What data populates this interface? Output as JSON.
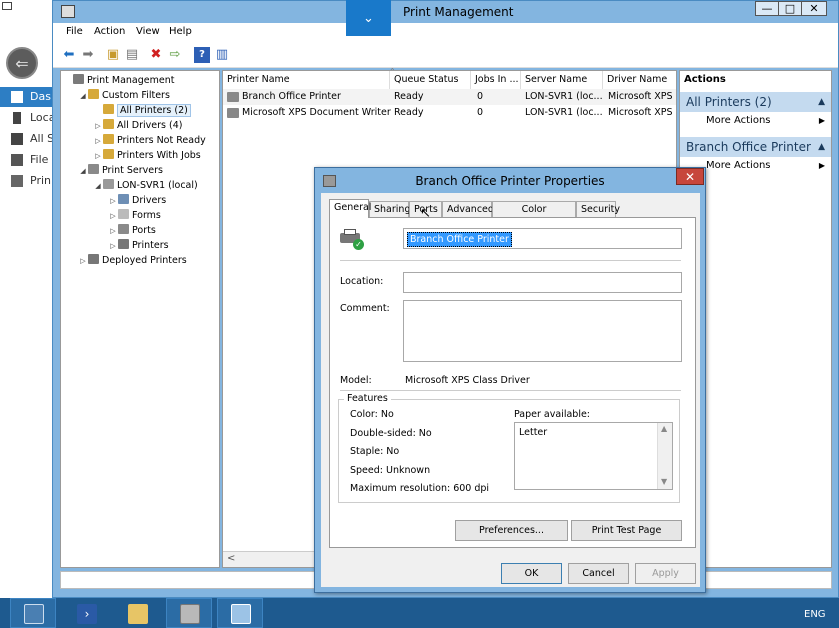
{
  "server_manager": {
    "sidebar": [
      {
        "label": "Das",
        "icon": "dashboard-icon",
        "active": true
      },
      {
        "label": "Loca",
        "icon": "local-server-icon",
        "active": false
      },
      {
        "label": "All S",
        "icon": "all-servers-icon",
        "active": false
      },
      {
        "label": "File",
        "icon": "file-services-icon",
        "active": false
      },
      {
        "label": "Prin",
        "icon": "print-services-icon",
        "active": false
      }
    ]
  },
  "mmc": {
    "title": "Print Management",
    "title_visible": "Print Management",
    "menu": [
      "File",
      "Action",
      "View",
      "Help"
    ],
    "window_buttons": {
      "minimize": "—",
      "maximize": "□",
      "close": "✕"
    },
    "tree": [
      {
        "label": "Print Management",
        "level": 0,
        "expander": "",
        "icon": "print-management-icon"
      },
      {
        "label": "Custom Filters",
        "level": 1,
        "expander": "◢",
        "icon": "filter-folder-icon"
      },
      {
        "label": "All Printers (2)",
        "level": 2,
        "expander": "",
        "icon": "filter-icon",
        "selected": true
      },
      {
        "label": "All Drivers (4)",
        "level": 2,
        "expander": "▷",
        "icon": "filter-icon"
      },
      {
        "label": "Printers Not Ready",
        "level": 2,
        "expander": "▷",
        "icon": "filter-icon"
      },
      {
        "label": "Printers With Jobs",
        "level": 2,
        "expander": "▷",
        "icon": "filter-icon"
      },
      {
        "label": "Print Servers",
        "level": 1,
        "expander": "◢",
        "icon": "servers-icon"
      },
      {
        "label": "LON-SVR1 (local)",
        "level": 2,
        "expander": "◢",
        "icon": "server-icon"
      },
      {
        "label": "Drivers",
        "level": 3,
        "expander": "▷",
        "icon": "drivers-icon"
      },
      {
        "label": "Forms",
        "level": 3,
        "expander": "▷",
        "icon": "forms-icon"
      },
      {
        "label": "Ports",
        "level": 3,
        "expander": "▷",
        "icon": "ports-icon"
      },
      {
        "label": "Printers",
        "level": 3,
        "expander": "▷",
        "icon": "printers-icon"
      },
      {
        "label": "Deployed Printers",
        "level": 1,
        "expander": "▷",
        "icon": "deployed-printers-icon"
      }
    ],
    "list": {
      "columns": [
        "Printer Name",
        "Queue Status",
        "Jobs In ...",
        "Server Name",
        "Driver Name"
      ],
      "rows": [
        [
          "Branch Office Printer",
          "Ready",
          "0",
          "LON-SVR1 (loc...",
          "Microsoft XPS C"
        ],
        [
          "Microsoft XPS Document Writer",
          "Ready",
          "0",
          "LON-SVR1 (loc...",
          "Microsoft XPS D"
        ]
      ],
      "scroll_left": "<"
    },
    "actions": {
      "header": "Actions",
      "sections": [
        {
          "title": "All Printers (2)",
          "items": [
            "More Actions"
          ]
        },
        {
          "title": "Branch Office Printer",
          "items": [
            "More Actions"
          ]
        }
      ]
    }
  },
  "dialog": {
    "title": "Branch Office Printer Properties",
    "close": "✕",
    "tabs": [
      "General",
      "Sharing",
      "Ports",
      "Advanced",
      "Color Management",
      "Security"
    ],
    "active_tab": "General",
    "printer_name": "Branch Office Printer",
    "location_label": "Location:",
    "location_value": "",
    "comment_label": "Comment:",
    "comment_value": "",
    "model_label": "Model:",
    "model_value": "Microsoft XPS Class Driver",
    "features_label": "Features",
    "features": {
      "color": "Color: No",
      "double_sided": "Double-sided: No",
      "staple": "Staple: No",
      "speed": "Speed: Unknown",
      "max_resolution": "Maximum resolution: 600 dpi"
    },
    "paper_label": "Paper available:",
    "paper_options": [
      "Letter"
    ],
    "buttons": {
      "preferences": "Preferences...",
      "print_test_page": "Print Test Page",
      "ok": "OK",
      "cancel": "Cancel",
      "apply": "Apply"
    }
  },
  "taskbar": {
    "items": [
      "server-manager-icon",
      "powershell-icon",
      "file-explorer-icon",
      "print-management-icon",
      "control-panel-icon"
    ],
    "language": "ENG"
  },
  "dropdown_tab": "⌄"
}
